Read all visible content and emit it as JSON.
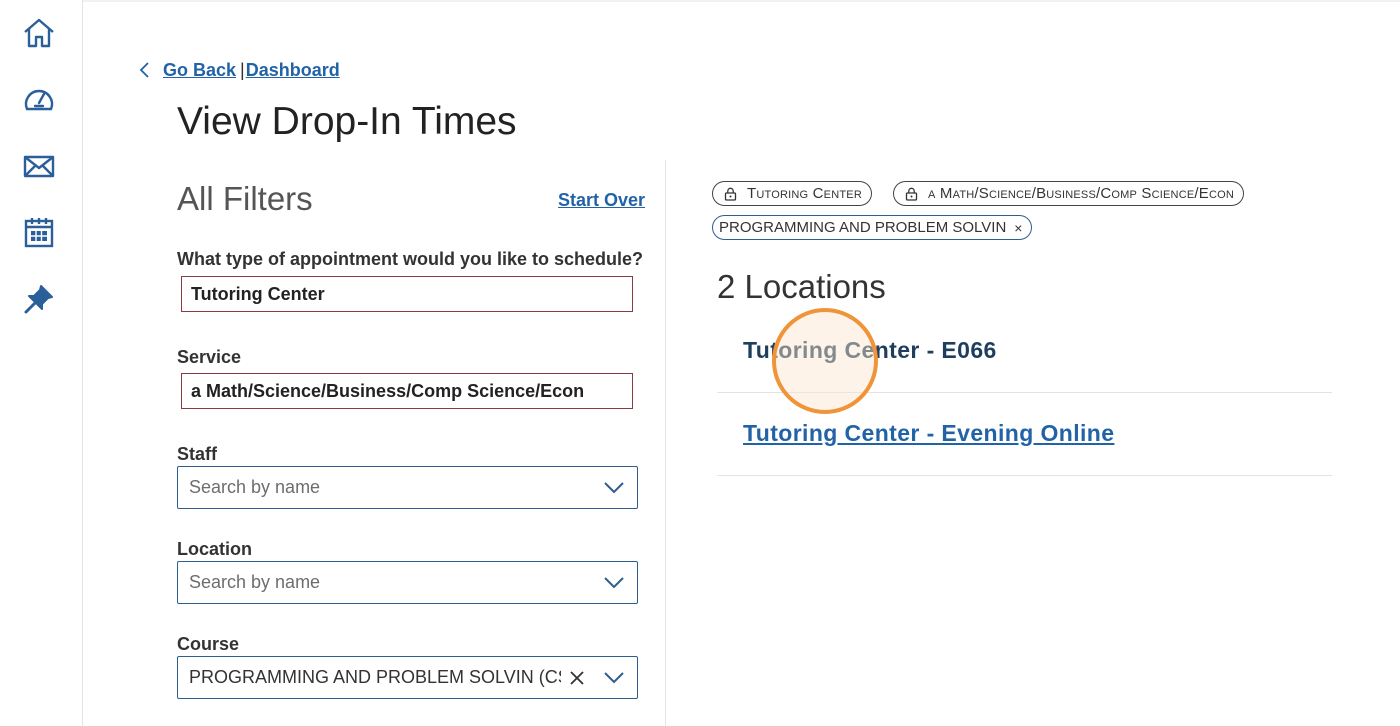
{
  "sidebar": {
    "items": [
      {
        "icon": "home-icon"
      },
      {
        "icon": "dashboard-gauge-icon"
      },
      {
        "icon": "mail-icon"
      },
      {
        "icon": "calendar-icon"
      },
      {
        "icon": "pin-icon"
      }
    ]
  },
  "breadcrumb": {
    "back_label": "Go Back",
    "separator": "|",
    "dashboard_label": "Dashboard"
  },
  "page_title": "View Drop-In Times",
  "filters": {
    "title": "All Filters",
    "start_over": "Start Over",
    "appointment_type": {
      "label": "What type of appointment would you like to schedule?",
      "value": "Tutoring Center"
    },
    "service": {
      "label": "Service",
      "value": "a Math/Science/Business/Comp Science/Econ"
    },
    "staff": {
      "label": "Staff",
      "placeholder": "Search by name"
    },
    "location": {
      "label": "Location",
      "placeholder": "Search by name"
    },
    "course": {
      "label": "Course",
      "value": "PROGRAMMING AND PROBLEM SOLVIN (CSCI-"
    }
  },
  "chips": [
    {
      "label": "Tutoring Center",
      "locked": true
    },
    {
      "label": "a Math/Science/Business/Comp Science/Econ",
      "locked": true
    },
    {
      "label": "PROGRAMMING AND PROBLEM SOLVIN",
      "removable": true,
      "remove_symbol": "×"
    }
  ],
  "results": {
    "count_label": "2 Locations",
    "locations": [
      {
        "name": "Tutoring Center - E066"
      },
      {
        "name": "Tutoring Center - Evening Online"
      }
    ]
  },
  "colors": {
    "link": "#2263a7",
    "sidebar_icon": "#2b5f9a",
    "cursor_highlight": "#f0943a",
    "required_border": "#8a3a43"
  }
}
